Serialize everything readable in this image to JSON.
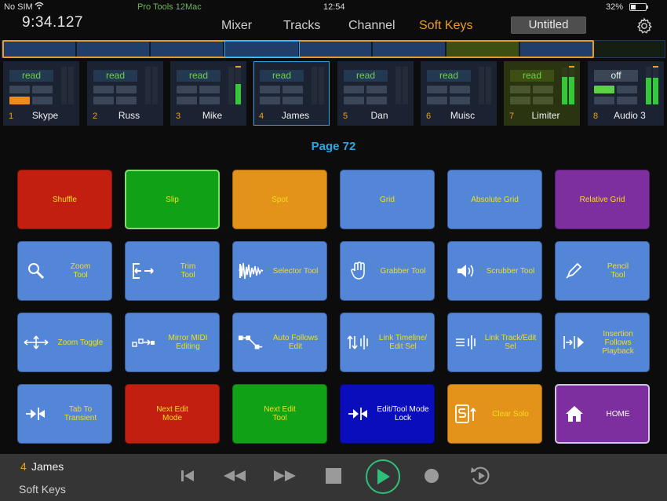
{
  "status_bar": {
    "carrier": "No SIM",
    "app": "Pro Tools 12Mac",
    "clock": "12:54",
    "battery_pct": "32%",
    "battery_level": 0.32
  },
  "header": {
    "timecode": "9:34.127",
    "tabs": [
      {
        "label": "Mixer",
        "active": false
      },
      {
        "label": "Tracks",
        "active": false
      },
      {
        "label": "Channel",
        "active": false
      },
      {
        "label": "Soft Keys",
        "active": true
      }
    ],
    "session_title": "Untitled",
    "icons": {
      "settings": "gear-icon",
      "wifi": "wifi-icon"
    }
  },
  "tracks": [
    {
      "num": "1",
      "name": "Skype",
      "automation": "read",
      "selected": false,
      "meter_level": 0,
      "color": "#1b2332"
    },
    {
      "num": "2",
      "name": "Russ",
      "automation": "read",
      "selected": false,
      "meter_level": 0,
      "color": "#1b2332"
    },
    {
      "num": "3",
      "name": "Mike",
      "automation": "read",
      "selected": false,
      "meter_level": 0.55,
      "color": "#1b2332"
    },
    {
      "num": "4",
      "name": "James",
      "automation": "read",
      "selected": true,
      "meter_level": 0,
      "color": "#1b2332"
    },
    {
      "num": "5",
      "name": "Dan",
      "automation": "read",
      "selected": false,
      "meter_level": 0,
      "color": "#1b2332"
    },
    {
      "num": "6",
      "name": "Muisc",
      "automation": "read",
      "selected": false,
      "meter_level": 0,
      "color": "#1b2332"
    },
    {
      "num": "7",
      "name": "Limiter",
      "automation": "read",
      "selected": false,
      "meter_level": 0.72,
      "color": "#2a3411"
    },
    {
      "num": "8",
      "name": "Audio 3",
      "automation": "off",
      "selected": false,
      "meter_level": 0.7,
      "color": "#1b2332"
    }
  ],
  "page_label": "Page 72",
  "soft_keys": [
    [
      {
        "label": "Shuffle",
        "color": "red",
        "icon": null
      },
      {
        "label": "Slip",
        "color": "green",
        "icon": null,
        "highlight": "green"
      },
      {
        "label": "Spot",
        "color": "orange",
        "icon": null
      },
      {
        "label": "Grid",
        "color": "blue",
        "icon": null
      },
      {
        "label": "Absolute Grid",
        "color": "blue",
        "icon": null
      },
      {
        "label": "Relative Grid",
        "color": "purple",
        "icon": null
      }
    ],
    [
      {
        "label": "Zoom\nTool",
        "color": "blue",
        "icon": "magnifier-icon"
      },
      {
        "label": "Trim\nTool",
        "color": "blue",
        "icon": "trim-icon"
      },
      {
        "label": "Selector Tool",
        "color": "blue",
        "icon": "waveform-selector-icon"
      },
      {
        "label": "Grabber Tool",
        "color": "blue",
        "icon": "grabber-hand-icon"
      },
      {
        "label": "Scrubber Tool",
        "color": "blue",
        "icon": "speaker-icon"
      },
      {
        "label": "Pencil\nTool",
        "color": "blue",
        "icon": "pencil-icon"
      }
    ],
    [
      {
        "label": "Zoom Toggle",
        "color": "blue",
        "icon": "zoom-toggle-icon"
      },
      {
        "label": "Mirror MIDI\nEditing",
        "color": "blue",
        "icon": "mirror-midi-icon"
      },
      {
        "label": "Auto Follows\nEdit",
        "color": "blue",
        "icon": "auto-follows-icon"
      },
      {
        "label": "Link Timeline/\nEdit Sel",
        "color": "blue",
        "icon": "link-timeline-icon"
      },
      {
        "label": "Link Track/Edit\nSel",
        "color": "blue",
        "icon": "link-track-icon"
      },
      {
        "label": "Insertion Follows\nPlayback",
        "color": "blue",
        "icon": "insertion-follows-icon"
      }
    ],
    [
      {
        "label": "Tab To Transient",
        "color": "blue",
        "icon": "tab-transient-icon"
      },
      {
        "label": "Next Edit\nMode",
        "color": "red",
        "icon": null
      },
      {
        "label": "Next Edit\nTool",
        "color": "green",
        "icon": null
      },
      {
        "label": "Edit/Tool Mode\nLock",
        "color": "navy",
        "icon": "tab-transient-icon",
        "text_color": "white"
      },
      {
        "label": "Clear Solo",
        "color": "orange",
        "icon": "clear-solo-icon"
      },
      {
        "label": "HOME",
        "color": "purple",
        "icon": "home-icon",
        "highlight": "light",
        "text_color": "white"
      }
    ]
  ],
  "bottom_bar": {
    "track_num": "4",
    "track_name": "James",
    "mode": "Soft Keys",
    "transport": [
      "return-to-zero-icon",
      "rewind-icon",
      "fast-forward-icon",
      "stop-icon",
      "play-icon",
      "record-icon",
      "loop-icon"
    ]
  }
}
